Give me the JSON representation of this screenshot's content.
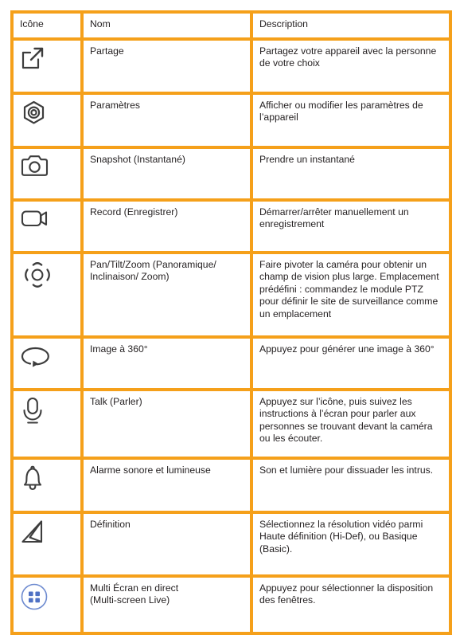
{
  "colors": {
    "table_border": "#F5A01A",
    "icon_stroke": "#3d3d3d",
    "multiscreen_blue": "#4F71C4",
    "background": "#FFFFFF",
    "text": "#231F20"
  },
  "table": {
    "headers": {
      "icon": "Icône",
      "name": "Nom",
      "description": "Description"
    },
    "rows": [
      {
        "icon_name": "share-external-link-icon",
        "name": "Partage",
        "description": "Partagez votre appareil avec la personne de votre choix"
      },
      {
        "icon_name": "settings-hex-gear-icon",
        "name": "Paramètres",
        "description": "Afficher ou modifier les paramètres de l’appareil"
      },
      {
        "icon_name": "camera-snapshot-icon",
        "name": "Snapshot (Instantané)",
        "description": "Prendre un instantané"
      },
      {
        "icon_name": "video-record-icon",
        "name": "Record (Enregistrer)",
        "description": "Démarrer/arrêter manuellement un enregistrement"
      },
      {
        "icon_name": "pan-tilt-zoom-icon",
        "name": "Pan/Tilt/Zoom (Panoramique/ Inclinaison/ Zoom)",
        "description": "Faire pivoter la caméra pour obtenir un champ de vision plus large. Emplacement prédéfini : commandez le module PTZ pour définir le site de surveillance comme un emplacement"
      },
      {
        "icon_name": "image-360-rotate-icon",
        "name": "Image à 360°",
        "description": "Appuyez pour générer une image à 360°"
      },
      {
        "icon_name": "microphone-talk-icon",
        "name": "Talk (Parler)",
        "description": "Appuyez sur l’icône, puis suivez les instructions à l’écran pour parler aux personnes se trouvant devant la caméra ou les écouter."
      },
      {
        "icon_name": "bell-alarm-icon",
        "name": "Alarme sonore et lumineuse",
        "description": "Son et lumière pour dissuader les intrus."
      },
      {
        "icon_name": "definition-resolution-icon",
        "name": "Définition",
        "description": "Sélectionnez la résolution vidéo parmi Haute définition (Hi-Def), ou Basique (Basic)."
      },
      {
        "icon_name": "multi-screen-grid-icon",
        "name": "Multi Écran en direct\n(Multi-screen Live)",
        "description": "Appuyez pour sélectionner la disposition des fenêtres."
      }
    ]
  }
}
